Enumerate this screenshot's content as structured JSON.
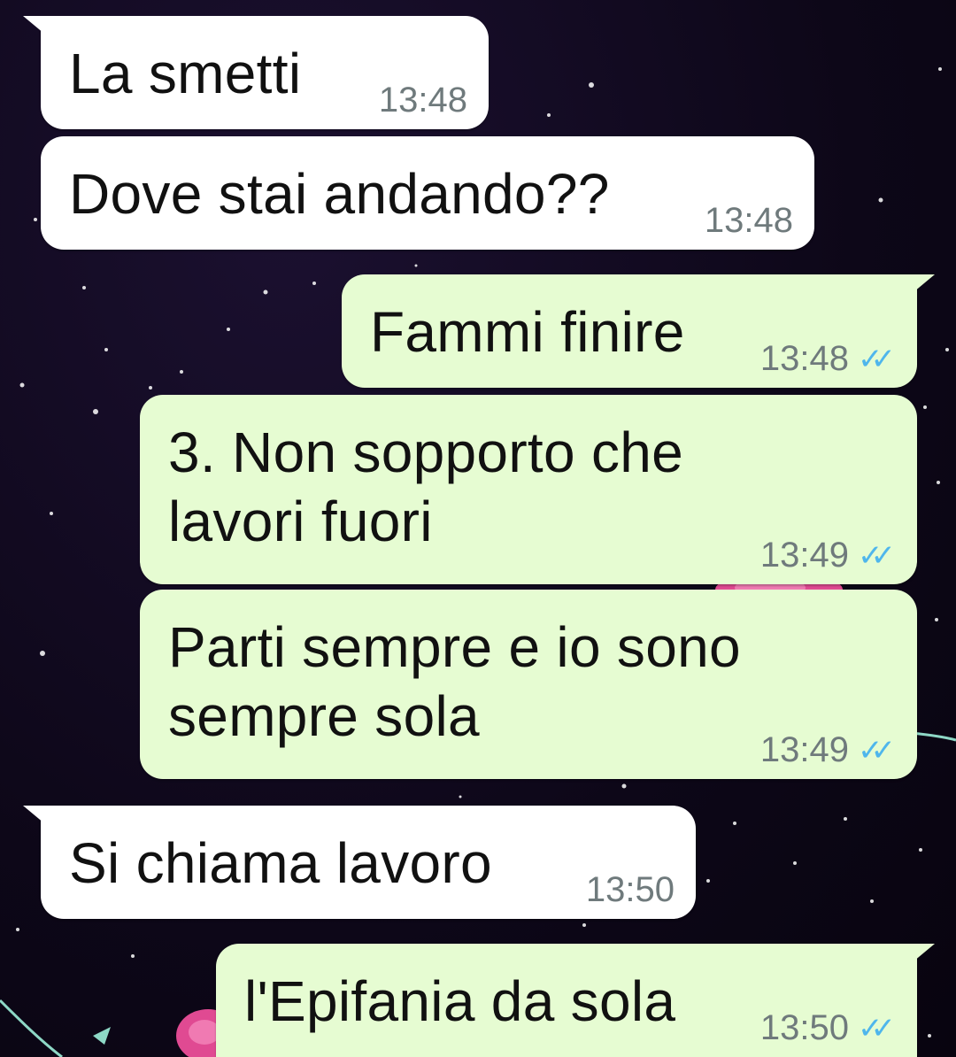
{
  "colors": {
    "background": "#120a20",
    "incoming_bubble": "#ffffff",
    "outgoing_bubble": "#e6fcd2",
    "timestamp": "#6f7a7c",
    "read_ticks": "#4fb6ec"
  },
  "icons": {
    "read_receipt": "double-check-icon"
  },
  "messages": [
    {
      "direction": "incoming",
      "text": "La smetti",
      "time": "13:48"
    },
    {
      "direction": "incoming",
      "text": "Dove stai andando??",
      "time": "13:48"
    },
    {
      "direction": "outgoing",
      "text": "Fammi finire",
      "time": "13:48",
      "status": "read"
    },
    {
      "direction": "outgoing",
      "text": "3. Non sopporto che\nlavori fuori",
      "time": "13:49",
      "status": "read"
    },
    {
      "direction": "outgoing",
      "text": "Parti sempre e io sono\nsempre sola",
      "time": "13:49",
      "status": "read"
    },
    {
      "direction": "incoming",
      "text": "Si chiama lavoro",
      "time": "13:50"
    },
    {
      "direction": "outgoing",
      "text": "l'Epifania da sola",
      "time": "13:50",
      "status": "read"
    }
  ]
}
